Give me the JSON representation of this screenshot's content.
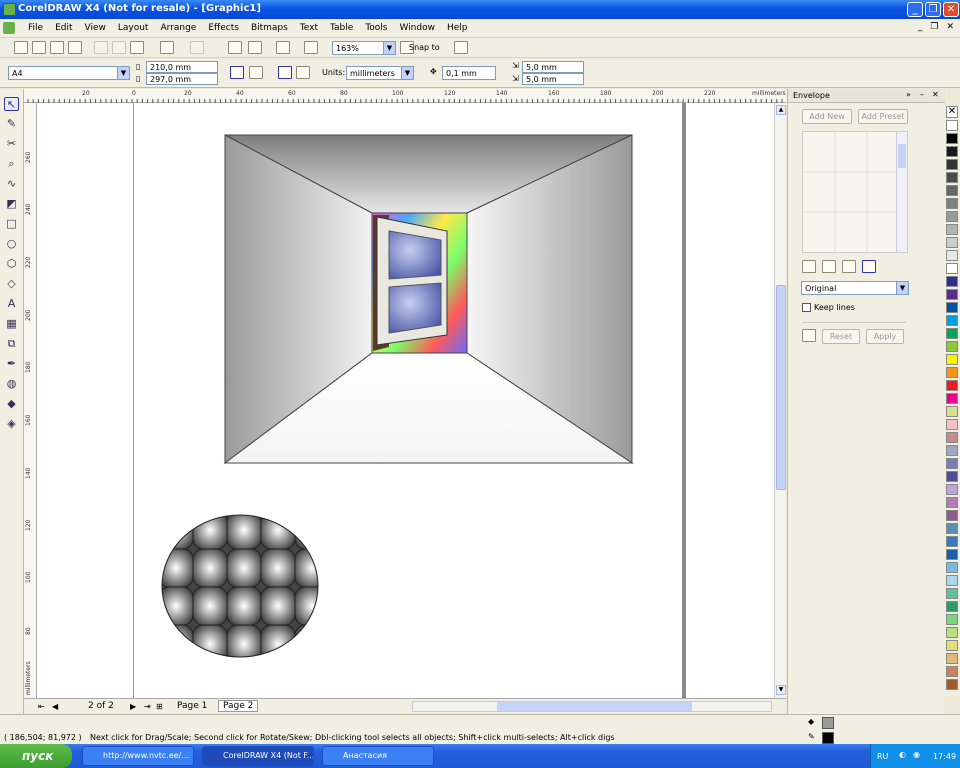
{
  "window": {
    "title": "CorelDRAW X4 (Not for resale) - [Graphic1]"
  },
  "menu": [
    "File",
    "Edit",
    "View",
    "Layout",
    "Arrange",
    "Effects",
    "Bitmaps",
    "Text",
    "Table",
    "Tools",
    "Window",
    "Help"
  ],
  "toolbar": {
    "zoom": "163%",
    "snap_to": "Snap to"
  },
  "propbar": {
    "paper": "A4",
    "width": "210,0 mm",
    "height": "297,0 mm",
    "units_label": "Units:",
    "units": "millimeters",
    "nudge": "0,1 mm",
    "dup_x": "5,0 mm",
    "dup_y": "5,0 mm"
  },
  "ruler": {
    "top_ticks": [
      "20",
      "0",
      "20",
      "40",
      "60",
      "80",
      "100",
      "120",
      "140",
      "160",
      "180",
      "200",
      "220"
    ],
    "top_unit": "millimeters",
    "left_ticks": [
      "260",
      "240",
      "220",
      "200",
      "180",
      "160",
      "140",
      "120",
      "100",
      "80"
    ],
    "left_unit": "millimeters"
  },
  "pages": {
    "count": "2 of 2",
    "tabs": [
      "Page 1",
      "Page 2"
    ]
  },
  "docker": {
    "title": "Envelope",
    "add_new": "Add New",
    "add_preset": "Add Preset",
    "mode": "Original",
    "keep_lines": "Keep lines",
    "reset": "Reset",
    "apply": "Apply"
  },
  "status": {
    "coords": "( 186,504; 81,972 )",
    "hint": "Next click for Drag/Scale; Second click for Rotate/Skew; Dbl-clicking tool selects all objects; Shift+click multi-selects; Alt+click digs"
  },
  "taskbar": {
    "start": "пуск",
    "tasks": [
      "http://www.nvtc.ee/...",
      "CorelDRAW X4 (Not F...",
      "Анастасия"
    ],
    "lang": "RU",
    "time": "17:49"
  },
  "palette": [
    "#ffffff",
    "#000000",
    "#1a1a1a",
    "#333333",
    "#4d4d4d",
    "#666666",
    "#808080",
    "#999999",
    "#b3b3b3",
    "#cccccc",
    "#e6e6e6",
    "#ffffff",
    "#2e2e8f",
    "#5a2e8f",
    "#0052a5",
    "#00a0e0",
    "#00a651",
    "#8cc63f",
    "#fff200",
    "#f7941d",
    "#ed1c24",
    "#ec008c",
    "#d6e08a",
    "#f4c2c2",
    "#c68b8b",
    "#a3a3c2",
    "#7b7bb5",
    "#4e4e9a",
    "#c2a3d6",
    "#b57bb5",
    "#8f5a8f",
    "#5a8fb5",
    "#3a78c3",
    "#1a5fa8",
    "#7ab8e0",
    "#a8d8f0",
    "#60c0a0",
    "#2e9a6a",
    "#7ad67a",
    "#b8e07a",
    "#e0e07a",
    "#e0b87a",
    "#c8845a",
    "#a05a2e"
  ]
}
